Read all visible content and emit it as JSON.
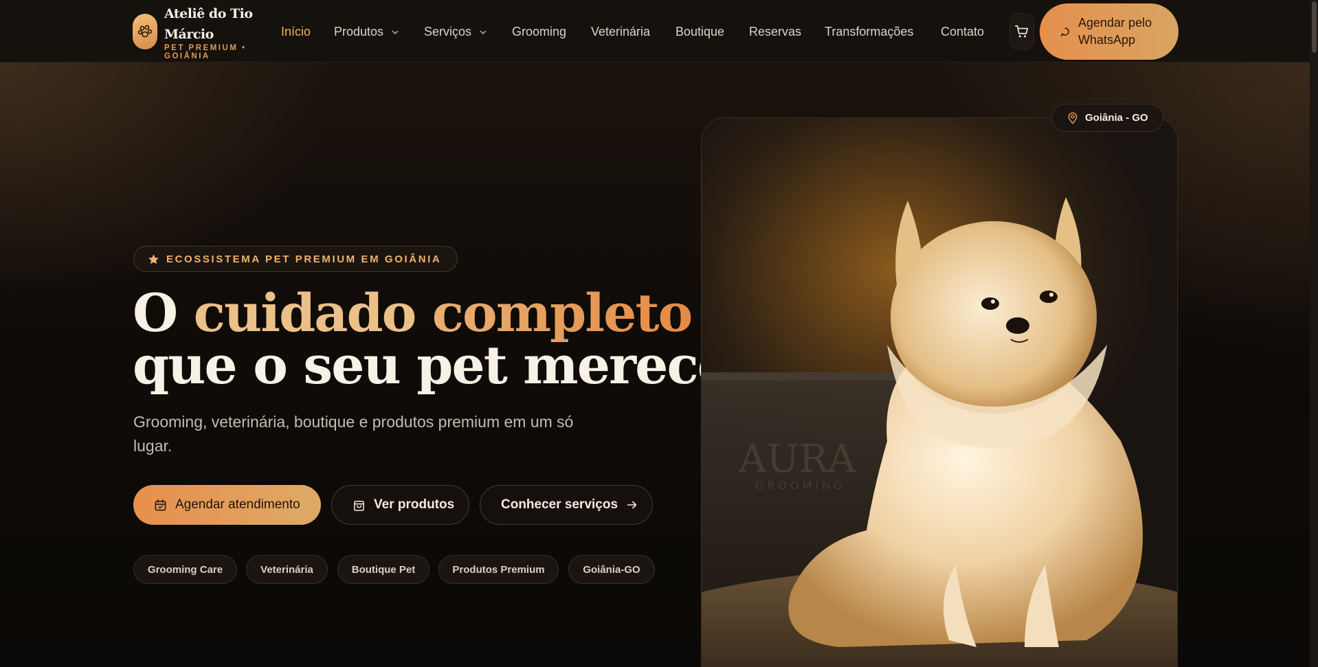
{
  "brand": {
    "name": "Ateliê do Tio Márcio",
    "tagline": "PET PREMIUM • GOIÂNIA"
  },
  "nav": {
    "items": [
      {
        "label": "Início",
        "active": true
      },
      {
        "label": "Produtos",
        "dropdown": true
      },
      {
        "label": "Serviços",
        "dropdown": true
      },
      {
        "label": "Grooming"
      },
      {
        "label": "Veterinária"
      },
      {
        "label": "Boutique"
      },
      {
        "label": "Reservas"
      },
      {
        "label": "Transformações"
      },
      {
        "label": "Contato"
      }
    ],
    "cart_icon": "cart-icon",
    "whatsapp_label": "Agendar pelo WhatsApp"
  },
  "hero": {
    "badge": "ECOSSISTEMA PET PREMIUM EM GOIÂNIA",
    "headline": {
      "prefix": "O ",
      "accent1": "cuidado ",
      "accent2": "completo",
      "line2": "que o seu pet merece"
    },
    "subtitle": "Grooming, veterinária, boutique e produtos premium em um só lugar.",
    "buttons": {
      "primary": "Agendar atendimento",
      "products": "Ver produtos",
      "services": "Conhecer serviços"
    },
    "chips": [
      "Grooming Care",
      "Veterinária",
      "Boutique Pet",
      "Produtos Premium",
      "Goiânia-GO"
    ],
    "location": "Goiânia - GO",
    "photo_watermark": {
      "brand": "AURA",
      "sub": "GROOMING"
    }
  },
  "colors": {
    "accent": "#e8934e",
    "accent_light": "#ecc089",
    "background": "#0d0a08",
    "header": "#15110d"
  }
}
